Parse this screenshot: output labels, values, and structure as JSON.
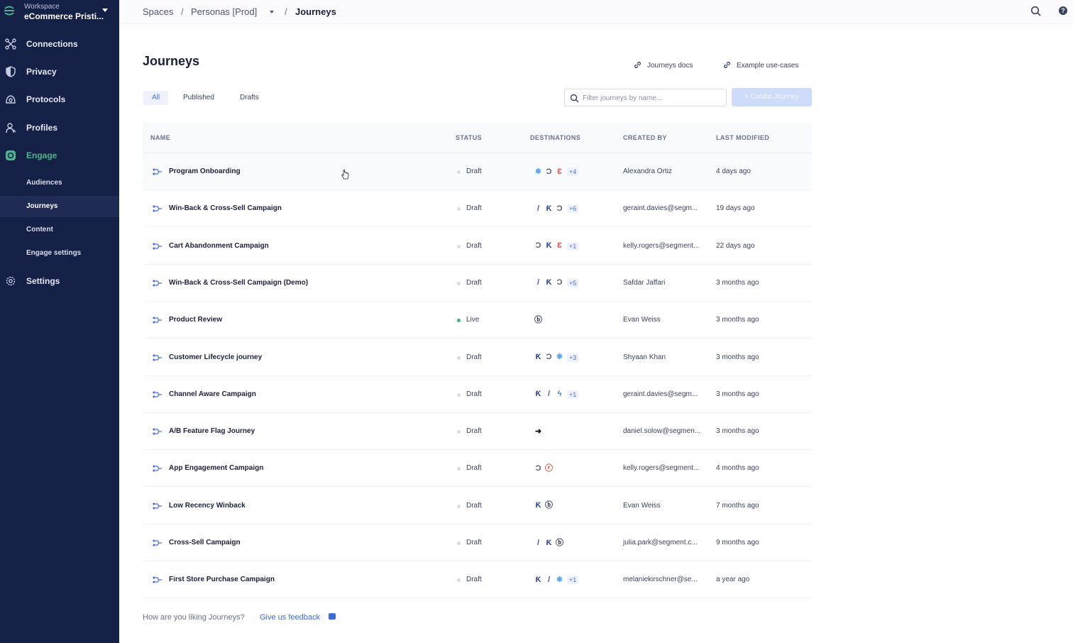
{
  "workspace": {
    "label": "Workspace",
    "name": "eCommerce Pristi..."
  },
  "sidebar": {
    "items": [
      {
        "label": "Connections",
        "icon": "connections-icon"
      },
      {
        "label": "Privacy",
        "icon": "shield-icon"
      },
      {
        "label": "Protocols",
        "icon": "protocols-icon"
      },
      {
        "label": "Profiles",
        "icon": "profile-icon"
      },
      {
        "label": "Engage",
        "icon": "engage-icon"
      },
      {
        "label": "Settings",
        "icon": "gear-icon"
      }
    ],
    "engage_sub": [
      {
        "label": "Audiences"
      },
      {
        "label": "Journeys"
      },
      {
        "label": "Content"
      },
      {
        "label": "Engage settings"
      }
    ]
  },
  "breadcrumb": {
    "spaces": "Spaces",
    "space": "Personas [Prod]",
    "current": "Journeys",
    "sep": "/"
  },
  "page": {
    "title": "Journeys",
    "docs_link": "Journeys docs",
    "examples_link": "Example use-cases",
    "tabs": [
      "All",
      "Published",
      "Drafts"
    ],
    "filter_placeholder": "Filter journeys by name...",
    "create_label": "+   Create Journey"
  },
  "table": {
    "headers": {
      "name": "NAME",
      "status": "STATUS",
      "destinations": "DESTINATIONS",
      "created_by": "CREATED BY",
      "last_modified": "LAST MODIFIED"
    },
    "rows": [
      {
        "name": "Program Onboarding",
        "status": "Draft",
        "dests": [
          "snowflake",
          "ring",
          "circle-e"
        ],
        "more": "+4",
        "created_by": "Alexandra Ortiz",
        "modified": "4 days ago"
      },
      {
        "name": "Win-Back & Cross-Sell Campaign",
        "status": "Draft",
        "dests": [
          "slash",
          "k",
          "ring"
        ],
        "more": "+6",
        "created_by": "geraint.davies@segm...",
        "modified": "19 days ago"
      },
      {
        "name": "Cart Abandonment Campaign",
        "status": "Draft",
        "dests": [
          "ring",
          "k",
          "circle-e"
        ],
        "more": "+1",
        "created_by": "kelly.rogers@segment...",
        "modified": "22 days ago"
      },
      {
        "name": "Win-Back & Cross-Sell Campaign (Demo)",
        "status": "Draft",
        "dests": [
          "slash",
          "k",
          "ring"
        ],
        "more": "+5",
        "created_by": "Safdar Jaffari",
        "modified": "3 months ago"
      },
      {
        "name": "Product Review",
        "status": "Live",
        "dests": [
          "circle-b"
        ],
        "more": "",
        "created_by": "Evan Weiss",
        "modified": "3 months ago"
      },
      {
        "name": "Customer Lifecycle journey",
        "status": "Draft",
        "dests": [
          "k",
          "ring",
          "snowflake"
        ],
        "more": "+3",
        "created_by": "Shyaan Khan",
        "modified": "3 months ago"
      },
      {
        "name": "Channel Aware Campaign",
        "status": "Draft",
        "dests": [
          "k",
          "slash",
          "bolt"
        ],
        "more": "+1",
        "created_by": "geraint.davies@segm...",
        "modified": "3 months ago"
      },
      {
        "name": "A/B Feature Flag Journey",
        "status": "Draft",
        "dests": [
          "arrow"
        ],
        "more": "",
        "created_by": "daniel.solow@segmen...",
        "modified": "3 months ago"
      },
      {
        "name": "App Engagement Campaign",
        "status": "Draft",
        "dests": [
          "ring",
          "circle-red"
        ],
        "more": "",
        "created_by": "kelly.rogers@segment...",
        "modified": "4 months ago"
      },
      {
        "name": "Low Recency Winback",
        "status": "Draft",
        "dests": [
          "k",
          "circle-b"
        ],
        "more": "",
        "created_by": "Evan Weiss",
        "modified": "7 months ago"
      },
      {
        "name": "Cross-Sell Campaign",
        "status": "Draft",
        "dests": [
          "slash",
          "k",
          "circle-b"
        ],
        "more": "",
        "created_by": "julia.park@segment.c...",
        "modified": "9 months ago"
      },
      {
        "name": "First Store Purchase Campaign",
        "status": "Draft",
        "dests": [
          "k",
          "slash",
          "snowflake"
        ],
        "more": "+1",
        "created_by": "melaniekirschner@se...",
        "modified": "a year ago"
      }
    ]
  },
  "feedback": {
    "prompt": "How are you liking Journeys?",
    "link": "Give us feedback"
  },
  "colors": {
    "sidebar": "#152046",
    "accent": "#4a6fe0",
    "engage": "#4fb58d",
    "live": "#3fb47f"
  }
}
